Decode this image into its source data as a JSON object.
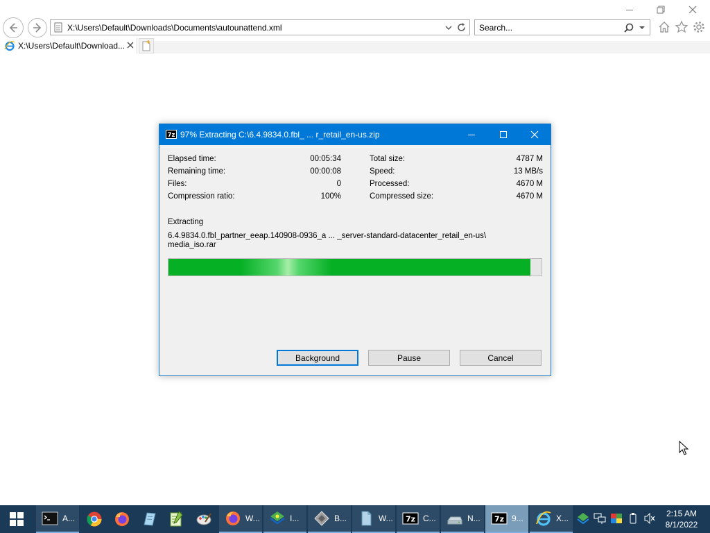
{
  "browser": {
    "address": "X:\\Users\\Default\\Downloads\\Documents\\autounattend.xml",
    "search_placeholder": "Search...",
    "tab_label": "X:\\Users\\Default\\Download...",
    "icons": [
      "back-arrow-icon",
      "forward-arrow-icon",
      "ie-logo-icon",
      "refresh-icon",
      "search-icon",
      "home-icon",
      "star-icon",
      "gear-icon",
      "close-icon",
      "new-tab-icon"
    ]
  },
  "dialog": {
    "title": "97% Extracting C:\\6.4.9834.0.fbl_ ... r_retail_en-us.zip",
    "stats_left": [
      {
        "label": "Elapsed time:",
        "value": "00:05:34"
      },
      {
        "label": "Remaining time:",
        "value": "00:00:08"
      },
      {
        "label": "Files:",
        "value": "0"
      },
      {
        "label": "Compression ratio:",
        "value": "100%"
      }
    ],
    "stats_right": [
      {
        "label": "Total size:",
        "value": "4787 M"
      },
      {
        "label": "Speed:",
        "value": "13 MB/s"
      },
      {
        "label": "Processed:",
        "value": "4670 M"
      },
      {
        "label": "Compressed size:",
        "value": "4670 M"
      }
    ],
    "extracting_label": "Extracting",
    "path_line1": "6.4.9834.0.fbl_partner_eeap.140908-0936_a ... _server-standard-datacenter_retail_en-us\\",
    "path_line2": "media_iso.rar",
    "progress_percent": 97,
    "buttons": {
      "background": "Background",
      "pause": "Pause",
      "cancel": "Cancel"
    },
    "accent_color": "#0078d7",
    "progress_color": "#06b025"
  },
  "taskbar": {
    "items": [
      {
        "label": "A...",
        "icon": "cmd-icon"
      },
      {
        "label": "",
        "icon": "chrome-icon"
      },
      {
        "label": "",
        "icon": "firefox-icon"
      },
      {
        "label": "",
        "icon": "notepad-icon"
      },
      {
        "label": "",
        "icon": "notepadpp-icon"
      },
      {
        "label": "",
        "icon": "paint-icon"
      },
      {
        "label": "W...",
        "icon": "firefox-icon"
      },
      {
        "label": "I...",
        "icon": "installer-icon"
      },
      {
        "label": "B...",
        "icon": "burn-icon"
      },
      {
        "label": "W...",
        "icon": "document-icon"
      },
      {
        "label": "C...",
        "icon": "7zip-icon"
      },
      {
        "label": "N...",
        "icon": "drive-icon"
      },
      {
        "label": "9...",
        "icon": "7zip-icon"
      },
      {
        "label": "X...",
        "icon": "ie-icon"
      }
    ],
    "clock_time": "2:15 AM",
    "clock_date": "8/1/2022",
    "bg_color": "#1a3a57"
  }
}
